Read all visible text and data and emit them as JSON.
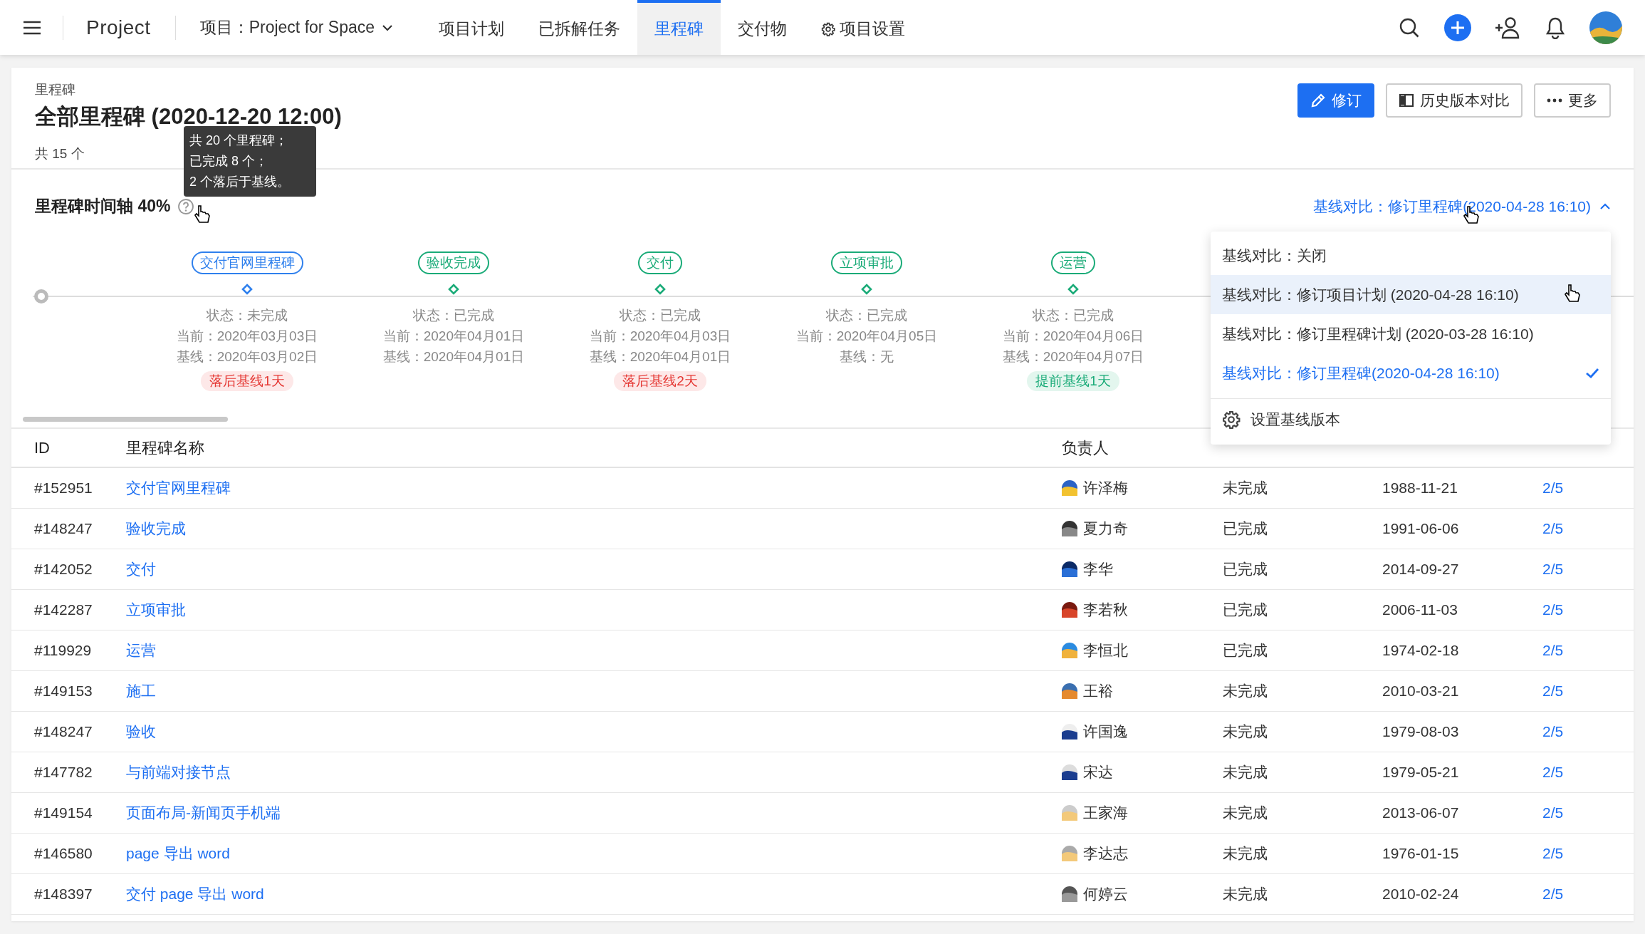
{
  "nav": {
    "brand": "Project",
    "project_select": "项目：Project for Space",
    "tabs": [
      {
        "label": "项目计划",
        "selected": false,
        "kind": "plain"
      },
      {
        "label": "已拆解任务",
        "selected": false,
        "kind": "plain"
      },
      {
        "label": "里程碑",
        "selected": true,
        "kind": "plain"
      },
      {
        "label": "交付物",
        "selected": false,
        "kind": "plain"
      },
      {
        "label": "项目设置",
        "selected": false,
        "kind": "settings"
      }
    ]
  },
  "header": {
    "breadcrumb": "里程碑",
    "title": "全部里程碑 (2020-12-20 12:00)",
    "count": "共 15 个",
    "buttons": [
      {
        "label": "修订",
        "kind": "primary"
      },
      {
        "label": "历史版本对比",
        "kind": "compare"
      },
      {
        "label": "更多",
        "kind": "more"
      }
    ]
  },
  "tooltip": [
    "共 20 个里程碑；",
    "已完成 8 个；",
    "2 个落后于基线。"
  ],
  "timeline": {
    "title": "里程碑时间轴 40%",
    "baseline_link": "基线对比：修订里程碑(2020-04-28 16:10)",
    "items": [
      {
        "tag": "交付官网里程碑",
        "color": "#2f80ed",
        "status": "状态：未完成",
        "current": "当前：2020年03月03日",
        "baseline": "基线：2020年03月02日",
        "badge": {
          "text": "落后基线1天",
          "kind": "behind"
        }
      },
      {
        "tag": "验收完成",
        "color": "#1aab78",
        "status": "状态：已完成",
        "current": "当前：2020年04月01日",
        "baseline": "基线：2020年04月01日"
      },
      {
        "tag": "交付",
        "color": "#1aab78",
        "status": "状态：已完成",
        "current": "当前：2020年04月03日",
        "baseline": "基线：2020年04月01日",
        "badge": {
          "text": "落后基线2天",
          "kind": "behind"
        }
      },
      {
        "tag": "立项审批",
        "color": "#1aab78",
        "status": "状态：已完成",
        "current": "当前：2020年04月05日",
        "baseline": "基线：无"
      },
      {
        "tag": "运营",
        "color": "#1aab78",
        "status": "状态：已完成",
        "current": "当前：2020年04月06日",
        "baseline": "基线：2020年04月07日",
        "badge": {
          "text": "提前基线1天",
          "kind": "ahead"
        }
      }
    ]
  },
  "dropdown": {
    "options": [
      {
        "label": "基线对比：关闭",
        "selected": false,
        "hovered": false
      },
      {
        "label": "基线对比：修订项目计划 (2020-04-28 16:10)",
        "selected": false,
        "hovered": true
      },
      {
        "label": "基线对比：修订里程碑计划 (2020-03-28 16:10)",
        "selected": false,
        "hovered": false
      },
      {
        "label": "基线对比：修订里程碑(2020-04-28 16:10)",
        "selected": true,
        "hovered": false
      }
    ],
    "footer": "设置基线版本"
  },
  "table": {
    "columns": [
      "ID",
      "里程碑名称",
      "负责人"
    ],
    "rows": [
      {
        "id": "#152951",
        "name": "交付官网里程碑",
        "owner": "许泽梅",
        "status": "未完成",
        "date": "1988-11-21",
        "deliverable": "2/5"
      },
      {
        "id": "#148247",
        "name": "验收完成",
        "owner": "夏力奇",
        "status": "已完成",
        "date": "1991-06-06",
        "deliverable": "2/5"
      },
      {
        "id": "#142052",
        "name": "交付",
        "owner": "李华",
        "status": "已完成",
        "date": "2014-09-27",
        "deliverable": "2/5"
      },
      {
        "id": "#142287",
        "name": "立项审批",
        "owner": "李若秋",
        "status": "已完成",
        "date": "2006-11-03",
        "deliverable": "2/5"
      },
      {
        "id": "#119929",
        "name": "运营",
        "owner": "李恒北",
        "status": "已完成",
        "date": "1974-02-18",
        "deliverable": "2/5"
      },
      {
        "id": "#149153",
        "name": "施工",
        "owner": "王裕",
        "status": "未完成",
        "date": "2010-03-21",
        "deliverable": "2/5"
      },
      {
        "id": "#148247",
        "name": "验收",
        "owner": "许国逸",
        "status": "未完成",
        "date": "1979-08-03",
        "deliverable": "2/5"
      },
      {
        "id": "#147782",
        "name": "与前端对接节点",
        "owner": "宋达",
        "status": "未完成",
        "date": "1979-05-21",
        "deliverable": "2/5"
      },
      {
        "id": "#149154",
        "name": "页面布局-新闻页手机端",
        "owner": "王家海",
        "status": "未完成",
        "date": "2013-06-07",
        "deliverable": "2/5"
      },
      {
        "id": "#146580",
        "name": "page 导出 word",
        "owner": "李达志",
        "status": "未完成",
        "date": "1976-01-15",
        "deliverable": "2/5"
      },
      {
        "id": "#148397",
        "name": "交付 page 导出 word",
        "owner": "何婷云",
        "status": "未完成",
        "date": "2010-02-24",
        "deliverable": "2/5"
      }
    ]
  }
}
